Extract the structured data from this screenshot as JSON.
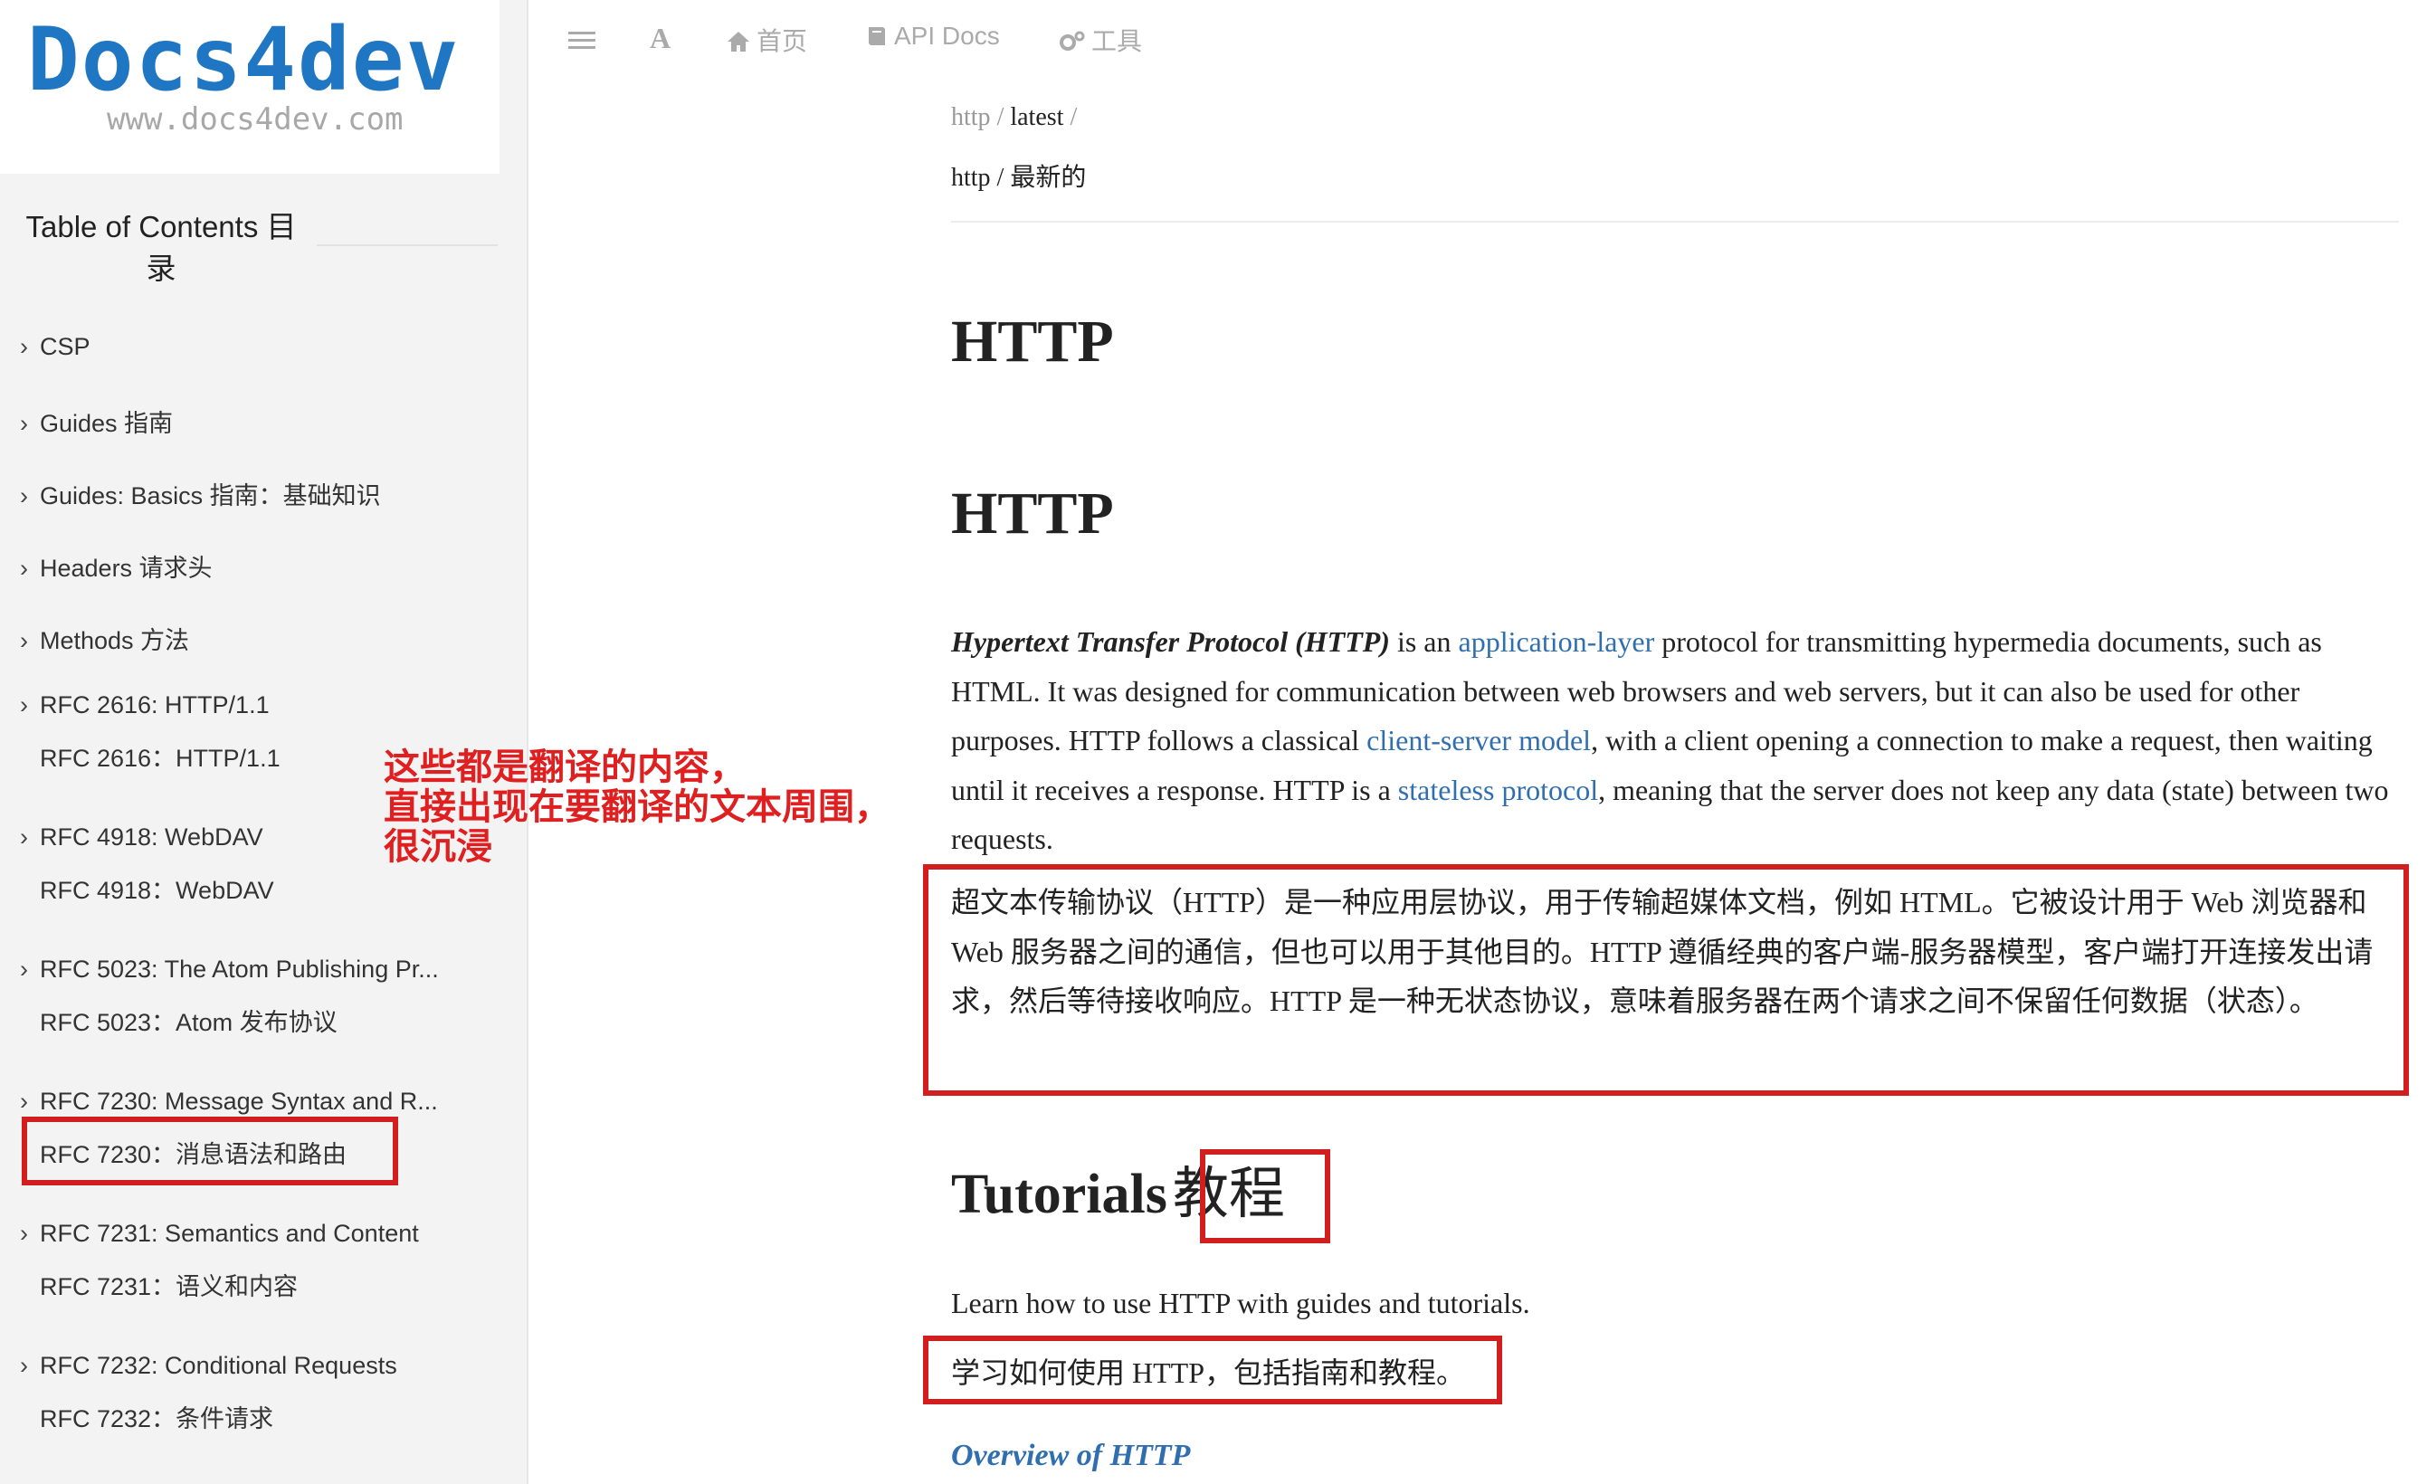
{
  "sidebar": {
    "logo_title": "Docs4dev",
    "logo_subtitle": "www.docs4dev.com",
    "toc_title_line1": "Table of Contents 目",
    "toc_title_line2": "录",
    "items": [
      {
        "label": "CSP",
        "sub": ""
      },
      {
        "label": "Guides  指南",
        "sub": ""
      },
      {
        "label": "Guides: Basics  指南：基础知识",
        "sub": ""
      },
      {
        "label": "Headers  请求头",
        "sub": ""
      },
      {
        "label": "Methods  方法",
        "sub": ""
      },
      {
        "label": "RFC 2616: HTTP/1.1",
        "sub": "RFC 2616：HTTP/1.1"
      },
      {
        "label": "RFC 4918: WebDAV",
        "sub": "RFC 4918：WebDAV"
      },
      {
        "label": "RFC 5023: The Atom Publishing Pr...",
        "sub": "RFC 5023：Atom 发布协议"
      },
      {
        "label": "RFC 7230: Message Syntax and R...",
        "sub": "RFC 7230：消息语法和路由"
      },
      {
        "label": "RFC 7231: Semantics and Content",
        "sub": "RFC 7231：语义和内容"
      },
      {
        "label": "RFC 7232: Conditional Requests",
        "sub": "RFC 7232：条件请求"
      }
    ]
  },
  "topbar": {
    "menu_icon": "menu-icon",
    "font_label": "A",
    "home_label": "首页",
    "api_docs_label": "API Docs",
    "tools_label": "工具"
  },
  "breadcrumb": {
    "part1": "http",
    "sep": "/",
    "part2": "latest",
    "subtitle": "http / 最新的"
  },
  "content": {
    "title1": "HTTP",
    "title2": "HTTP",
    "intro": {
      "strong": "Hypertext Transfer Protocol (HTTP)",
      "t1": " is an ",
      "link1": "application-layer",
      "t2": " protocol for transmitting hypermedia documents, such as HTML. It was designed for communication between web browsers and web servers, but it can also be used for other purposes. HTTP follows a classical ",
      "link2": "client-server model",
      "t3": ", with a client opening a connection to make a request, then waiting until it receives a response. HTTP is a ",
      "link3": "stateless protocol",
      "t4": ", meaning that the server does not keep any data (state) between two requests."
    },
    "intro_zh": "超文本传输协议（HTTP）是一种应用层协议，用于传输超媒体文档，例如 HTML。它被设计用于 Web 浏览器和 Web 服务器之间的通信，但也可以用于其他目的。HTTP 遵循经典的客户端-服务器模型，客户端打开连接发出请求，然后等待接收响应。HTTP 是一种无状态协议，意味着服务器在两个请求之间不保留任何数据（状态）。",
    "tutorials_en": "Tutorials",
    "tutorials_zh": "教程",
    "tutorials_lead": "Learn how to use HTTP with guides and tutorials.",
    "tutorials_lead_zh": "学习如何使用 HTTP，包括指南和教程。",
    "overview_link": "Overview of HTTP"
  },
  "annotation": {
    "text": "这些都是翻译的内容，\n直接出现在要翻译的文本周围，\n很沉浸",
    "color": "#e02020"
  },
  "colors": {
    "link": "#2f6fb0",
    "logo": "#1f77c4",
    "annotation_box": "#d11f1f"
  }
}
